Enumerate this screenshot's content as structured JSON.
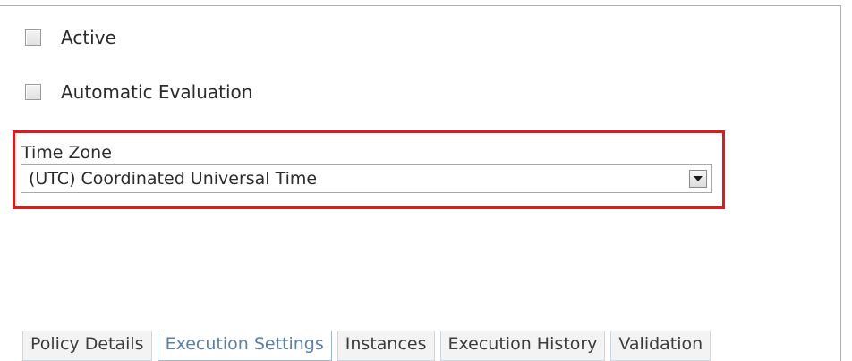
{
  "checkboxes": {
    "active": {
      "label": "Active",
      "checked": false
    },
    "automatic_evaluation": {
      "label": "Automatic Evaluation",
      "checked": false
    }
  },
  "time_zone": {
    "label": "Time Zone",
    "selected_value": "(UTC) Coordinated Universal Time",
    "highlight_color": "#e0191c"
  },
  "tabs": [
    {
      "label": "Policy Details",
      "selected": false
    },
    {
      "label": "Execution Settings",
      "selected": true
    },
    {
      "label": "Instances",
      "selected": false
    },
    {
      "label": "Execution History",
      "selected": false
    },
    {
      "label": "Validation",
      "selected": false
    }
  ],
  "icons": {
    "dropdown": "chevron-down-icon"
  }
}
